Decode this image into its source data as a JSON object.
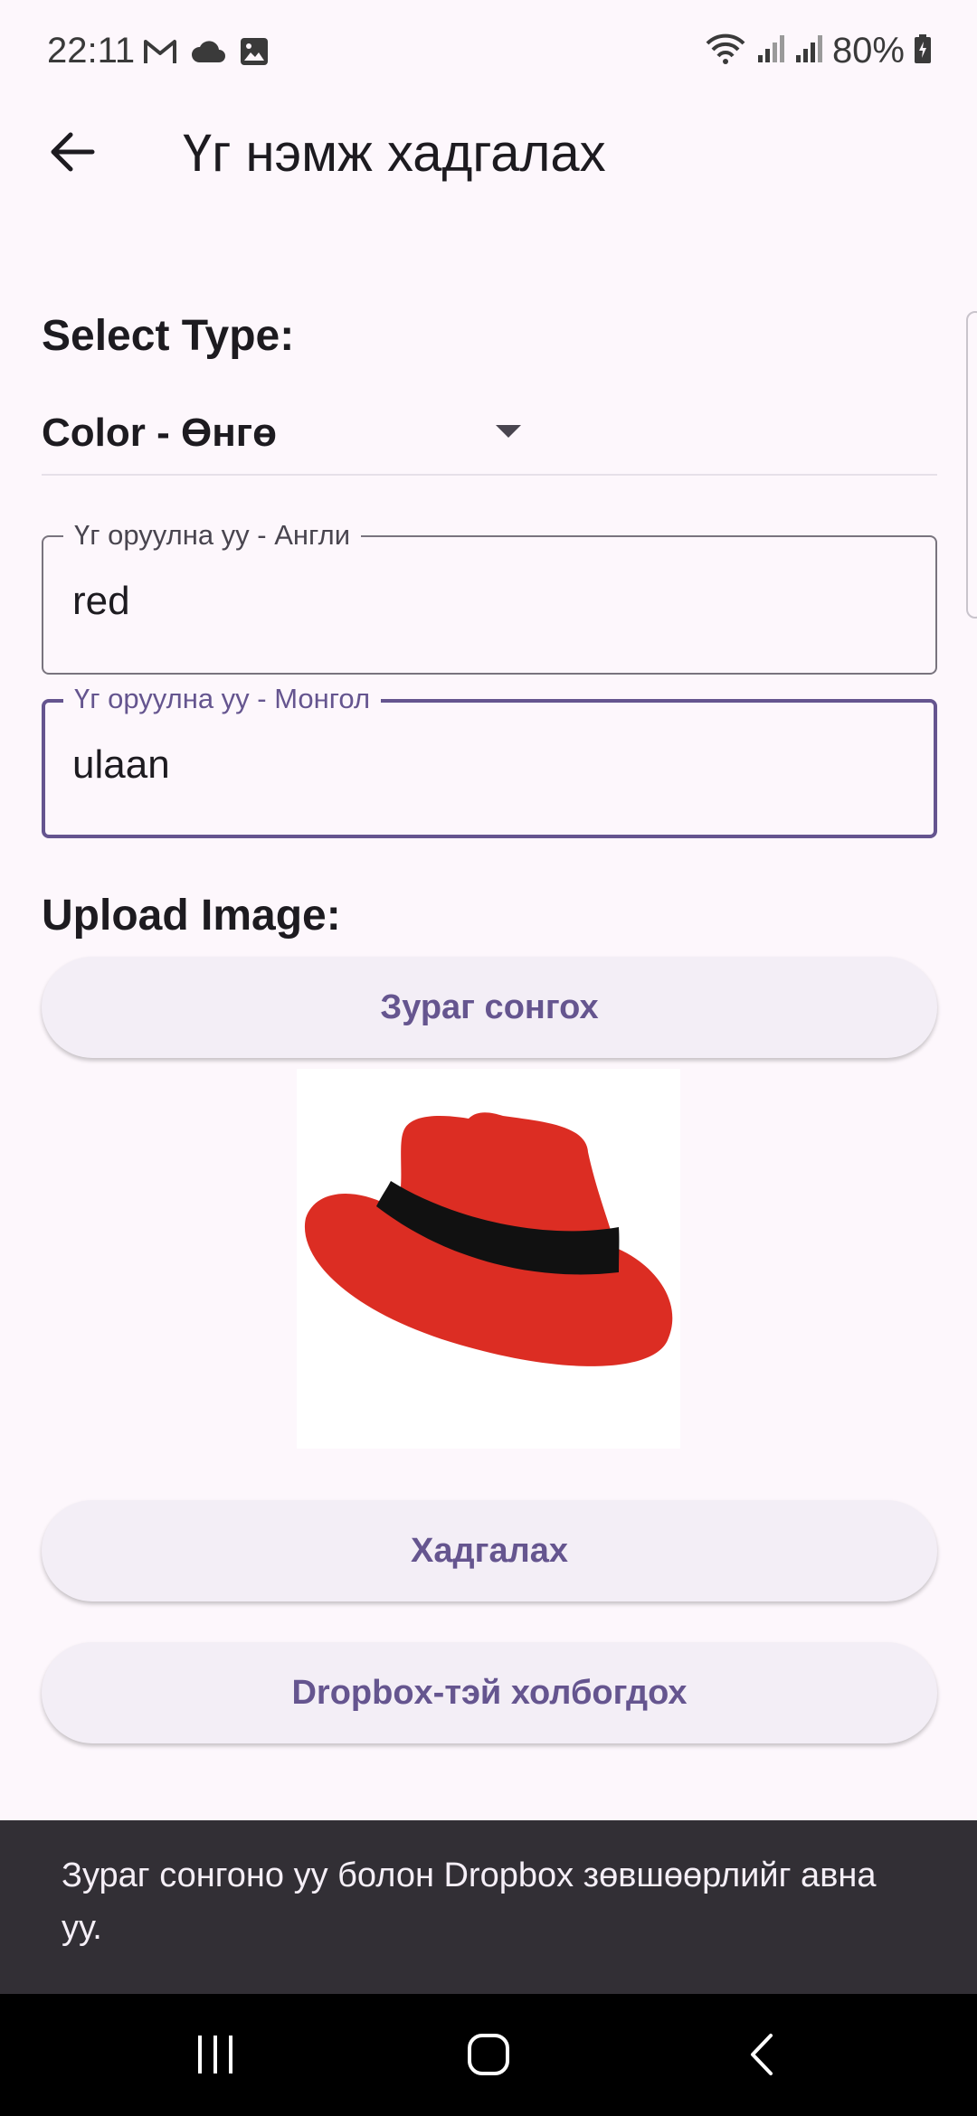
{
  "status_bar": {
    "time": "22:11",
    "battery": "80%",
    "left_icons": [
      "gmail-icon",
      "cloud-icon",
      "gallery-icon"
    ],
    "right_icons": [
      "wifi-icon",
      "signal-icon",
      "signal-icon",
      "battery-icon"
    ]
  },
  "app_bar": {
    "title": "Үг нэмж хадгалах",
    "back_icon": "arrow-left-icon"
  },
  "form": {
    "select_type_label": "Select Type:",
    "type_value": "Color - Өнгө",
    "english_field": {
      "label": "Үг оруулна уу - Англи",
      "value": "red"
    },
    "mongolian_field": {
      "label": "Үг оруулна уу - Монгол",
      "value": "ulaan"
    },
    "upload_label": "Upload Image:",
    "pick_image_button": "Зураг сонгох",
    "image_preview": "red-hat-image",
    "save_button": "Хадгалах",
    "dropbox_button": "Dropbox-тэй холбогдох"
  },
  "snackbar": {
    "message": "Зураг сонгоно уу болон Dropbox зөвшөөрлийг авна уу."
  },
  "nav_bar": {
    "icons": [
      "recents-icon",
      "home-icon",
      "back-icon"
    ]
  },
  "colors": {
    "background": "#fdf7fc",
    "accent": "#65558f",
    "hat_red": "#dc2d23",
    "snackbar": "#322f35"
  }
}
